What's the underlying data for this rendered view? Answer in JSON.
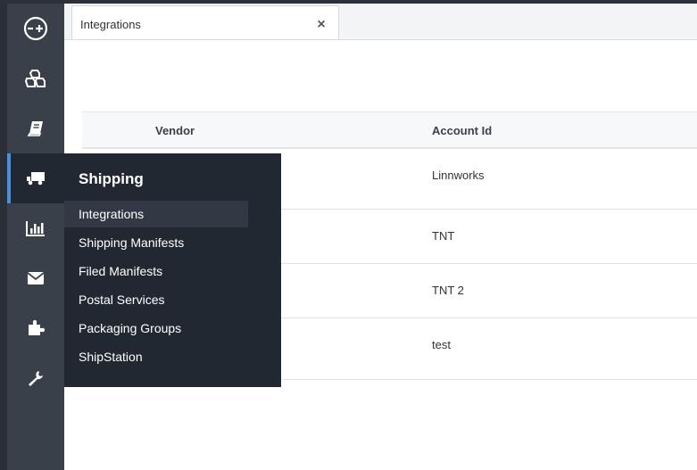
{
  "tab": {
    "label": "Integrations"
  },
  "grid": {
    "columns": {
      "vendor": "Vendor",
      "account": "Account Id"
    },
    "rows": [
      {
        "vendor": "",
        "account": "Linnworks"
      },
      {
        "vendor": "",
        "account": "TNT"
      },
      {
        "vendor": "",
        "account": "TNT 2"
      },
      {
        "vendor": "",
        "account": "test"
      }
    ]
  },
  "sidebar": {
    "items": [
      {
        "icon": "logo-icon"
      },
      {
        "icon": "cubes-icon"
      },
      {
        "icon": "book-icon"
      },
      {
        "icon": "truck-icon",
        "active": true
      },
      {
        "icon": "bar-chart-icon"
      },
      {
        "icon": "envelope-icon"
      },
      {
        "icon": "puzzle-icon"
      },
      {
        "icon": "wrench-icon"
      }
    ]
  },
  "flyout": {
    "title": "Shipping",
    "items": [
      {
        "label": "Integrations",
        "active": true
      },
      {
        "label": "Shipping Manifests"
      },
      {
        "label": "Filed Manifests"
      },
      {
        "label": "Postal Services"
      },
      {
        "label": "Packaging Groups"
      },
      {
        "label": "ShipStation"
      }
    ]
  },
  "colors": {
    "sidebar": "#3a4049",
    "flyout": "#222831",
    "accent": "#4a90e2"
  }
}
